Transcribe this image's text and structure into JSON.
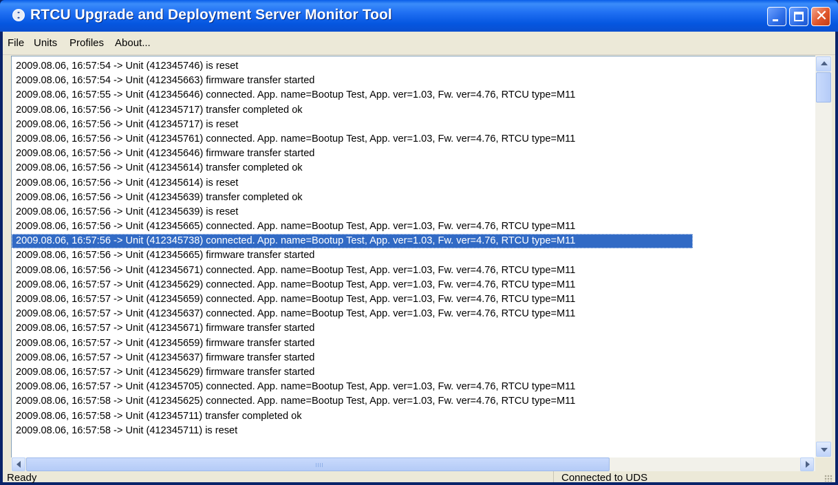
{
  "window": {
    "title": "RTCU Upgrade and Deployment Server Monitor Tool",
    "icon": "rtcu-app-icon",
    "controls": [
      "minimize-icon",
      "maximize-icon",
      "close-icon"
    ],
    "close_glyph": "✕"
  },
  "menu": {
    "items": [
      {
        "label": "File"
      },
      {
        "label": "Units"
      },
      {
        "label": "Profiles"
      },
      {
        "label": "About..."
      }
    ]
  },
  "log": {
    "selected_index": 12,
    "lines": [
      "2009.08.06, 16:57:54 -> Unit (412345746) is reset",
      "2009.08.06, 16:57:54 -> Unit (412345663) firmware transfer started",
      "2009.08.06, 16:57:55 -> Unit (412345646) connected. App. name=Bootup Test, App. ver=1.03, Fw. ver=4.76, RTCU type=M11",
      "2009.08.06, 16:57:56 -> Unit (412345717) transfer completed ok",
      "2009.08.06, 16:57:56 -> Unit (412345717) is reset",
      "2009.08.06, 16:57:56 -> Unit (412345761) connected. App. name=Bootup Test, App. ver=1.03, Fw. ver=4.76, RTCU type=M11",
      "2009.08.06, 16:57:56 -> Unit (412345646) firmware transfer started",
      "2009.08.06, 16:57:56 -> Unit (412345614) transfer completed ok",
      "2009.08.06, 16:57:56 -> Unit (412345614) is reset",
      "2009.08.06, 16:57:56 -> Unit (412345639) transfer completed ok",
      "2009.08.06, 16:57:56 -> Unit (412345639) is reset",
      "2009.08.06, 16:57:56 -> Unit (412345665) connected. App. name=Bootup Test, App. ver=1.03, Fw. ver=4.76, RTCU type=M11",
      "2009.08.06, 16:57:56 -> Unit (412345738) connected. App. name=Bootup Test, App. ver=1.03, Fw. ver=4.76, RTCU type=M11",
      "2009.08.06, 16:57:56 -> Unit (412345665) firmware transfer started",
      "2009.08.06, 16:57:56 -> Unit (412345671) connected. App. name=Bootup Test, App. ver=1.03, Fw. ver=4.76, RTCU type=M11",
      "2009.08.06, 16:57:57 -> Unit (412345629) connected. App. name=Bootup Test, App. ver=1.03, Fw. ver=4.76, RTCU type=M11",
      "2009.08.06, 16:57:57 -> Unit (412345659) connected. App. name=Bootup Test, App. ver=1.03, Fw. ver=4.76, RTCU type=M11",
      "2009.08.06, 16:57:57 -> Unit (412345637) connected. App. name=Bootup Test, App. ver=1.03, Fw. ver=4.76, RTCU type=M11",
      "2009.08.06, 16:57:57 -> Unit (412345671) firmware transfer started",
      "2009.08.06, 16:57:57 -> Unit (412345659) firmware transfer started",
      "2009.08.06, 16:57:57 -> Unit (412345637) firmware transfer started",
      "2009.08.06, 16:57:57 -> Unit (412345629) firmware transfer started",
      "2009.08.06, 16:57:57 -> Unit (412345705) connected. App. name=Bootup Test, App. ver=1.03, Fw. ver=4.76, RTCU type=M11",
      "2009.08.06, 16:57:58 -> Unit (412345625) connected. App. name=Bootup Test, App. ver=1.03, Fw. ver=4.76, RTCU type=M11",
      "2009.08.06, 16:57:58 -> Unit (412345711) transfer completed ok",
      "2009.08.06, 16:57:58 -> Unit (412345711) is reset"
    ]
  },
  "status": {
    "left": "Ready",
    "right": "Connected to UDS"
  },
  "colors": {
    "titlebar": "#0a5ee8",
    "selection": "#316ac5",
    "face": "#ece9d8"
  }
}
